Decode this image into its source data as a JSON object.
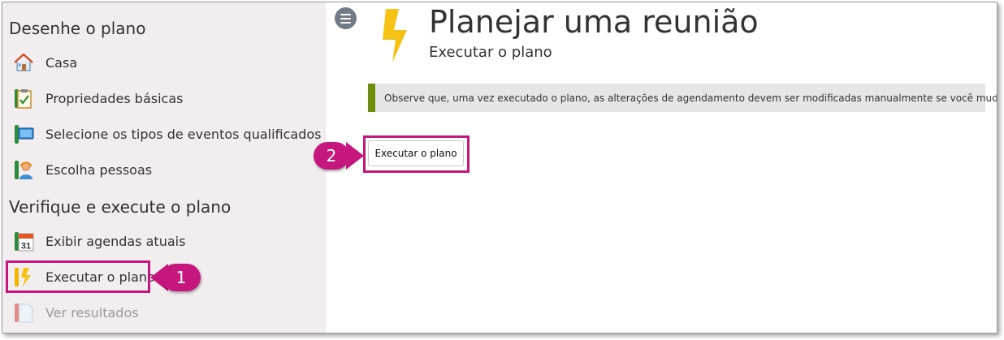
{
  "sidebar": {
    "sections": [
      {
        "title": "Desenhe o plano"
      },
      {
        "title": "Verifique e execute o plano"
      }
    ],
    "items": [
      {
        "label": "Casa",
        "icon": "house-icon"
      },
      {
        "label": "Propriedades básicas",
        "icon": "clipboard-check-icon"
      },
      {
        "label": "Selecione os tipos de eventos qualificados",
        "icon": "monitor-icon"
      },
      {
        "label": "Escolha pessoas",
        "icon": "person-icon"
      },
      {
        "label": "Exibir agendas atuais",
        "icon": "calendar-icon",
        "icon_text": "31"
      },
      {
        "label": "Executar o plano",
        "icon": "lightning-icon",
        "selected": true
      },
      {
        "label": "Ver resultados",
        "icon": "document-icon",
        "disabled": true
      }
    ]
  },
  "header": {
    "title": "Planejar uma reunião",
    "subtitle": "Executar o plano",
    "icon": "lightning-bolt-icon",
    "menu_icon": "hamburger-icon"
  },
  "main": {
    "notice": "Observe que, uma vez executado o plano, as alterações de agendamento devem ser modificadas manualmente se você mudar de ideia.",
    "execute_button": "Executar o plano"
  },
  "callouts": [
    "1",
    "2"
  ],
  "colors": {
    "accent": "#c6177f",
    "notice_bar": "#6f8c0b",
    "sidebar_bg": "#f2edee",
    "bolt": "#f6c215",
    "green_tab": "#2e8b3a"
  }
}
